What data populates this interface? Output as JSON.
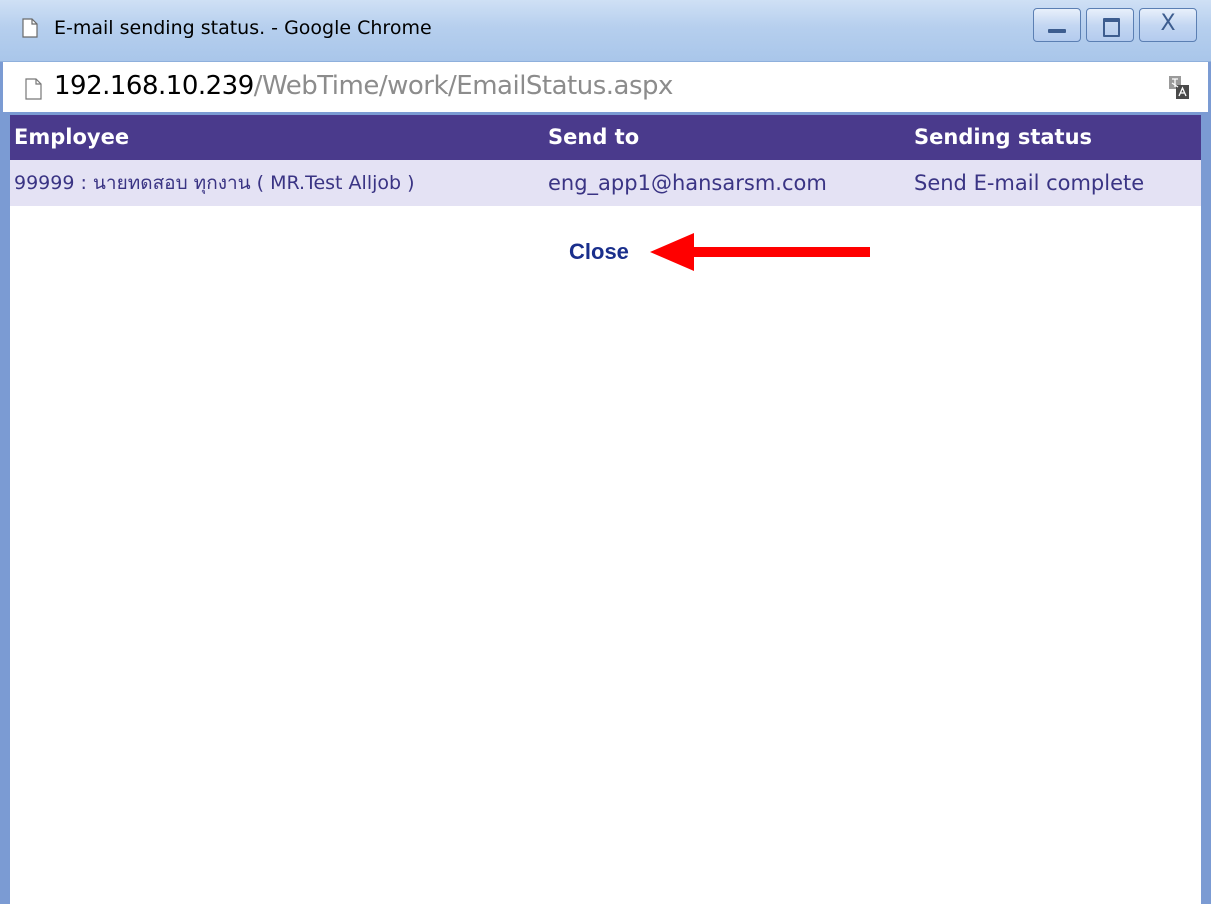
{
  "window": {
    "title": "E-mail sending status. - Google Chrome",
    "buttons": {
      "minimize": "minimize",
      "maximize": "maximize",
      "close": "X"
    }
  },
  "address_bar": {
    "host": "192.168.10.239",
    "path": "/WebTime/work/EmailStatus.aspx"
  },
  "table": {
    "headers": [
      "Employee",
      "Send to",
      "Sending status"
    ],
    "rows": [
      {
        "employee": "99999 : นายทดสอบ ทุกงาน ( MR.Test Alljob )",
        "send_to": "eng_app1@hansarsm.com",
        "status": "Send E-mail complete"
      }
    ]
  },
  "actions": {
    "close_label": "Close"
  },
  "colors": {
    "header_bg": "#4a3a8c",
    "row_bg": "#e4e2f4",
    "link": "#1a2f8c",
    "arrow": "#ff0000",
    "frame": "#7b9bd3"
  },
  "icons": [
    "page-icon",
    "document-icon",
    "translate-icon",
    "minimize-icon",
    "maximize-icon",
    "close-icon",
    "arrow-icon"
  ]
}
